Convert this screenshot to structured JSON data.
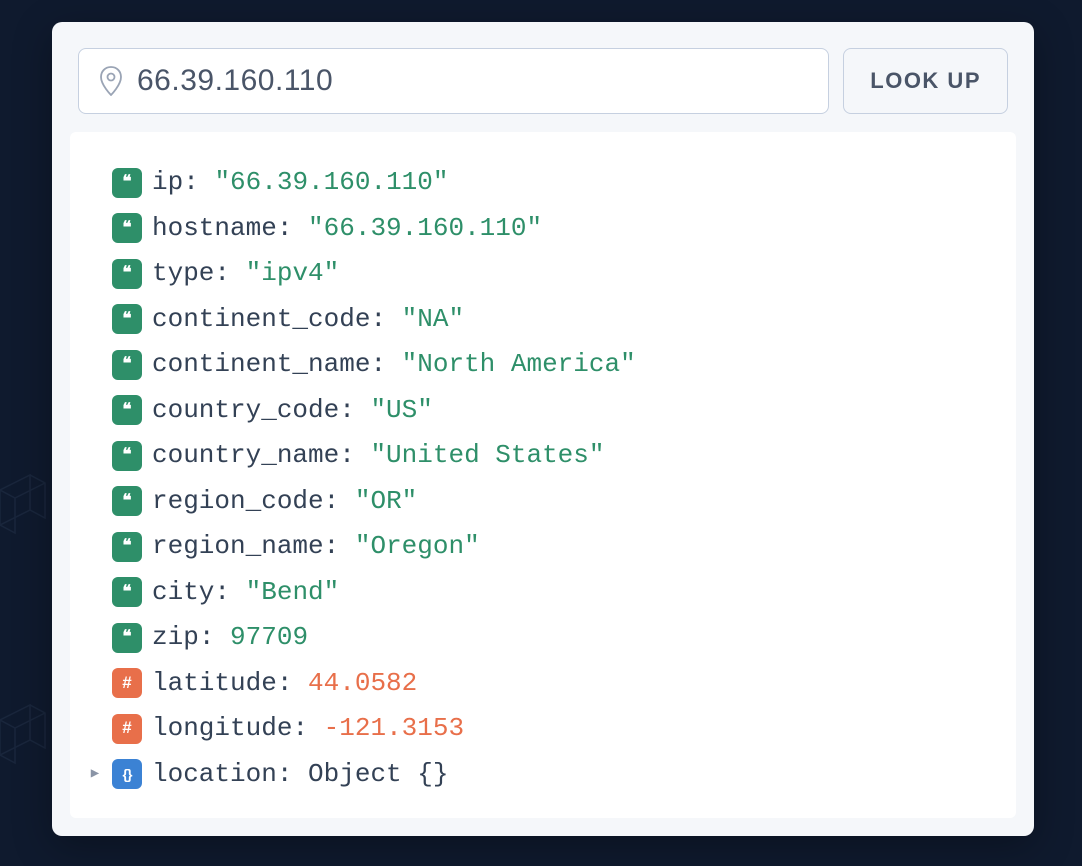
{
  "search": {
    "value": "66.39.160.110",
    "button_label": "LOOK UP"
  },
  "rows": [
    {
      "type": "string",
      "key": "ip",
      "value": "\"66.39.160.110\"",
      "valClass": "val-string"
    },
    {
      "type": "string",
      "key": "hostname",
      "value": "\"66.39.160.110\"",
      "valClass": "val-string"
    },
    {
      "type": "string",
      "key": "type",
      "value": "\"ipv4\"",
      "valClass": "val-string"
    },
    {
      "type": "string",
      "key": "continent_code",
      "value": "\"NA\"",
      "valClass": "val-string"
    },
    {
      "type": "string",
      "key": "continent_name",
      "value": "\"North America\"",
      "valClass": "val-string"
    },
    {
      "type": "string",
      "key": "country_code",
      "value": "\"US\"",
      "valClass": "val-string"
    },
    {
      "type": "string",
      "key": "country_name",
      "value": "\"United States\"",
      "valClass": "val-string"
    },
    {
      "type": "string",
      "key": "region_code",
      "value": "\"OR\"",
      "valClass": "val-string"
    },
    {
      "type": "string",
      "key": "region_name",
      "value": "\"Oregon\"",
      "valClass": "val-string"
    },
    {
      "type": "string",
      "key": "city",
      "value": "\"Bend\"",
      "valClass": "val-string"
    },
    {
      "type": "string",
      "key": "zip",
      "value": "97709",
      "valClass": "val-number-green"
    },
    {
      "type": "number",
      "key": "latitude",
      "value": "44.0582",
      "valClass": "val-number-orange"
    },
    {
      "type": "number",
      "key": "longitude",
      "value": "-121.3153",
      "valClass": "val-number-orange"
    },
    {
      "type": "object",
      "key": "location",
      "value": "Object {}",
      "valClass": "val-object",
      "expandable": true
    }
  ],
  "badge": {
    "string": "❝",
    "number": "#",
    "object": "{}"
  }
}
